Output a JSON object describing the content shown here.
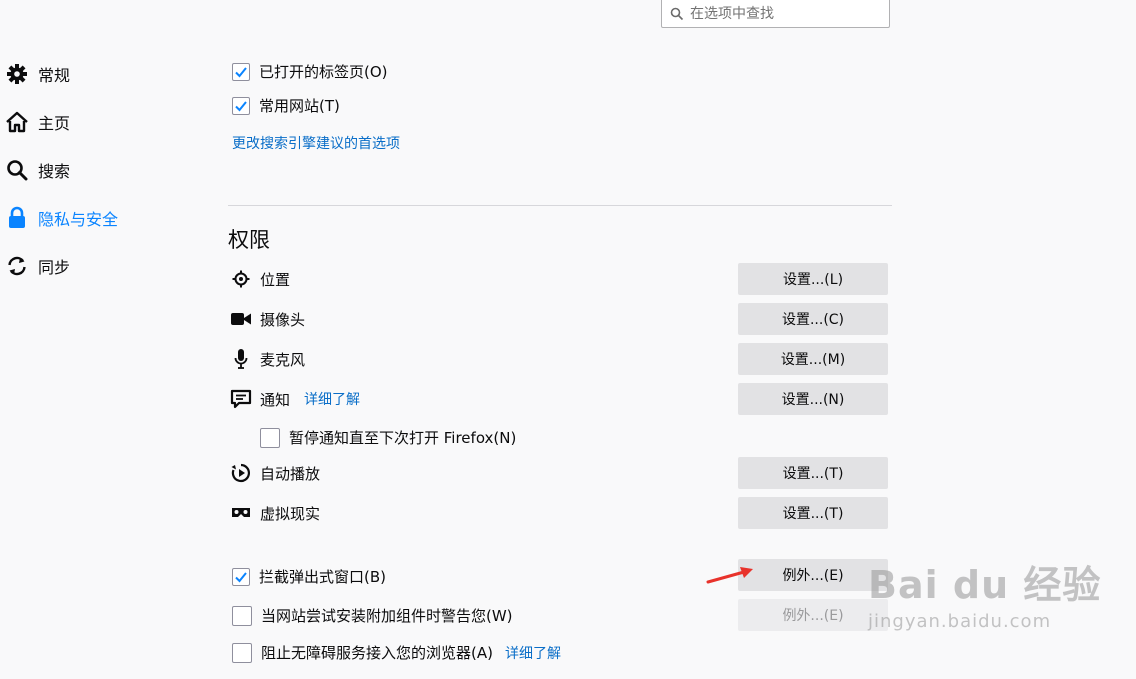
{
  "search": {
    "placeholder": "在选项中查找"
  },
  "sidebar": {
    "items": [
      {
        "label": "常规"
      },
      {
        "label": "主页"
      },
      {
        "label": "搜索"
      },
      {
        "label": "隐私与安全"
      },
      {
        "label": "同步"
      }
    ]
  },
  "suggestions": {
    "items": [
      {
        "label": "已打开的标签页(O)",
        "checked": true
      },
      {
        "label": "常用网站(T)",
        "checked": true
      }
    ],
    "change_link": "更改搜索引擎建议的首选项"
  },
  "permissions": {
    "title": "权限",
    "rows": [
      {
        "label": "位置",
        "button": "设置...(L)"
      },
      {
        "label": "摄像头",
        "button": "设置...(C)"
      },
      {
        "label": "麦克风",
        "button": "设置...(M)"
      },
      {
        "label": "通知",
        "link": "详细了解",
        "button": "设置...(N)"
      },
      {
        "label": "自动播放",
        "button": "设置...(T)"
      },
      {
        "label": "虚拟现实",
        "button": "设置...(T)"
      }
    ],
    "pause_notifications": {
      "label": "暂停通知直至下次打开 Firefox(N)",
      "checked": false
    },
    "block_popups": {
      "label": "拦截弹出式窗口(B)",
      "checked": true,
      "button": "例外...(E)"
    },
    "warn_addons": {
      "label": "当网站尝试安装附加组件时警告您(W)",
      "checked": false,
      "button": "例外...(E)",
      "button_disabled": true
    },
    "block_accessibility": {
      "label": "阻止无障碍服务接入您的浏览器(A)",
      "checked": false,
      "link": "详细了解"
    }
  },
  "watermark": {
    "main": "Bai du 经验",
    "sub": "jingyan.baidu.com"
  },
  "colors": {
    "accent": "#0a84ff",
    "link": "#0a6ec8",
    "arrow": "#e8322b"
  }
}
